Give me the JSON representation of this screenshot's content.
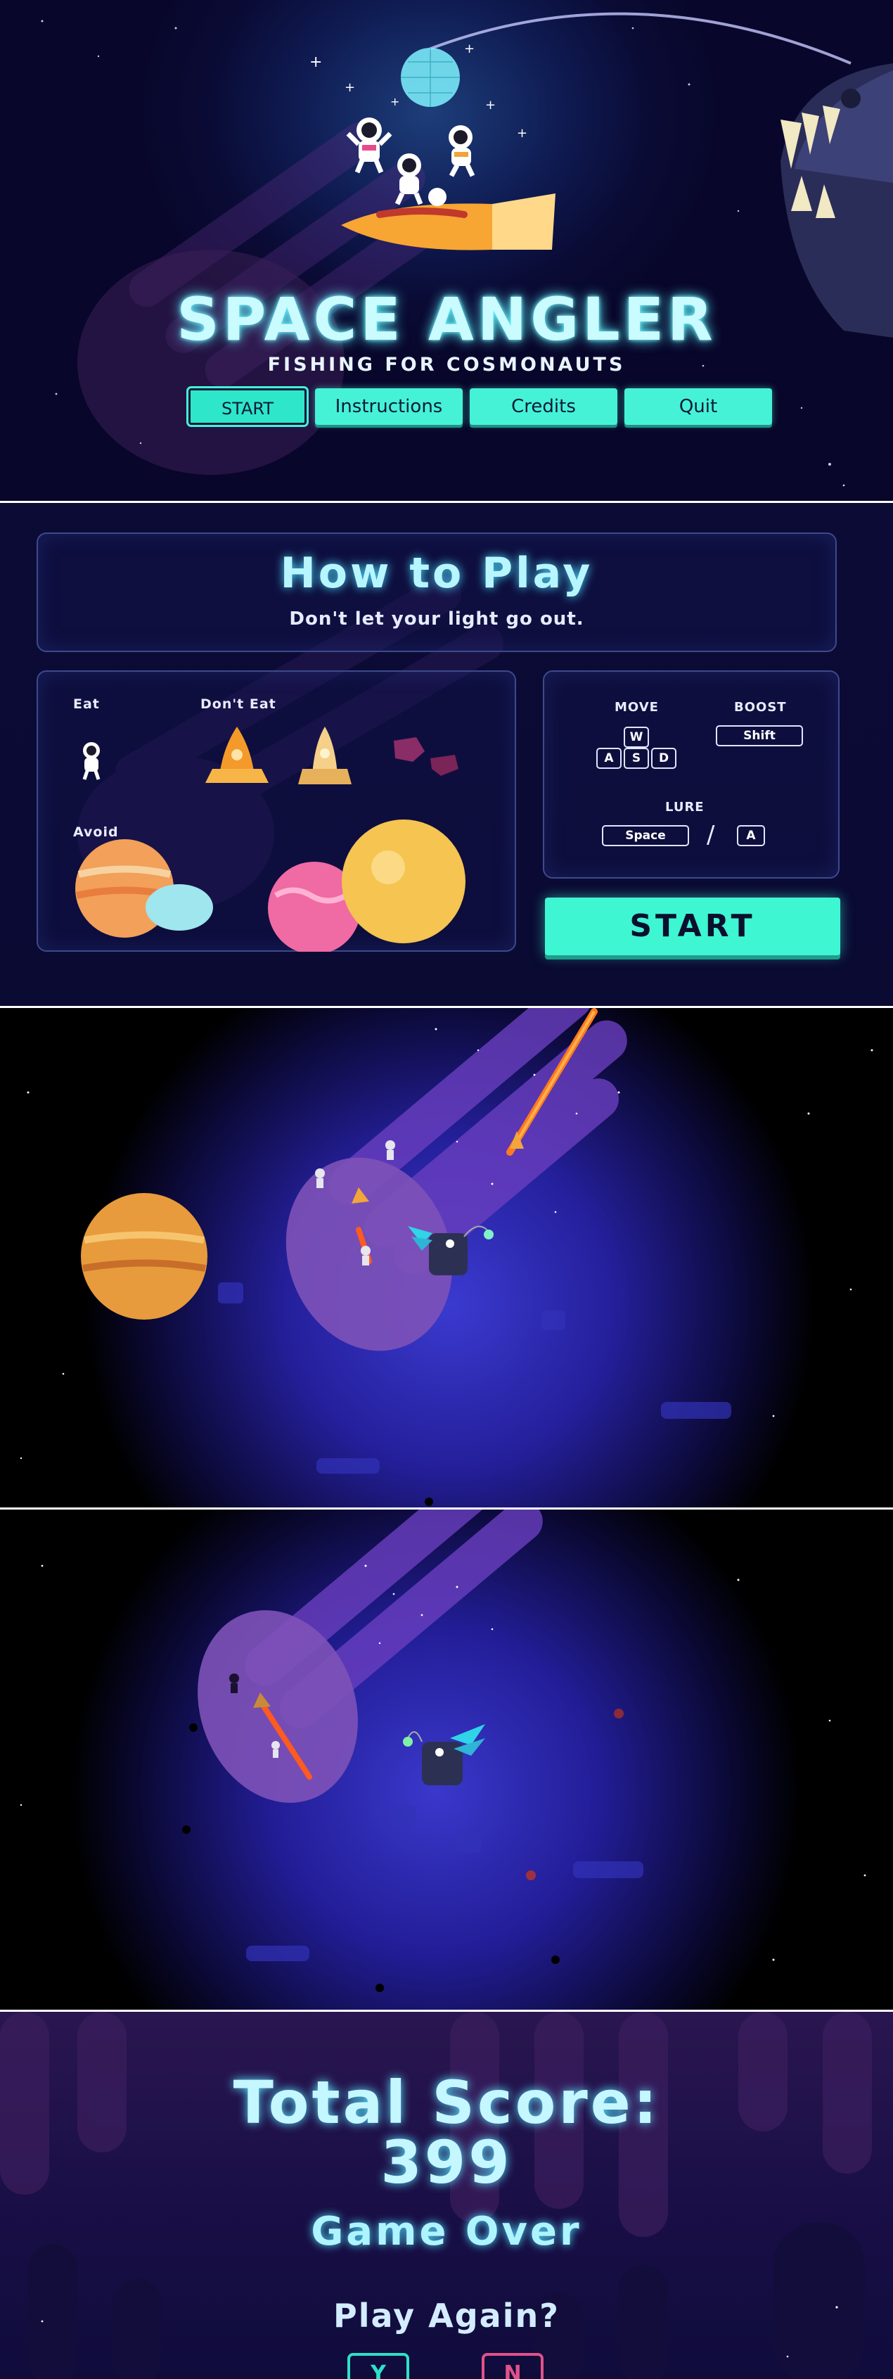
{
  "title_screen": {
    "title": "SPACE ANGLER",
    "subtitle": "FISHING FOR COSMONAUTS",
    "menu": {
      "start": "START",
      "instructions": "Instructions",
      "credits": "Credits",
      "quit": "Quit"
    }
  },
  "how_to_play": {
    "title": "How to Play",
    "subtitle": "Don't let your light go out.",
    "eat_label": "Eat",
    "dont_eat_label": "Don't Eat",
    "avoid_label": "Avoid",
    "controls": {
      "move_label": "MOVE",
      "boost_label": "BOOST",
      "lure_label": "LURE",
      "keys_move": [
        "W",
        "A",
        "S",
        "D"
      ],
      "key_boost": "Shift",
      "key_lure_1": "Space",
      "lure_separator": "/",
      "key_lure_2": "A"
    },
    "start_button": "START"
  },
  "game_over": {
    "score_label": "Total Score:",
    "score_value": "399",
    "status": "Game Over",
    "prompt": "Play Again?",
    "yes_button": "Y",
    "no_button": "N"
  },
  "colors": {
    "accent_teal": "#46f2d6",
    "title_glow": "#5ff6ff",
    "panel_navy": "#0a0a33",
    "yes_color": "#2fe0c8",
    "no_color": "#e0528a"
  }
}
